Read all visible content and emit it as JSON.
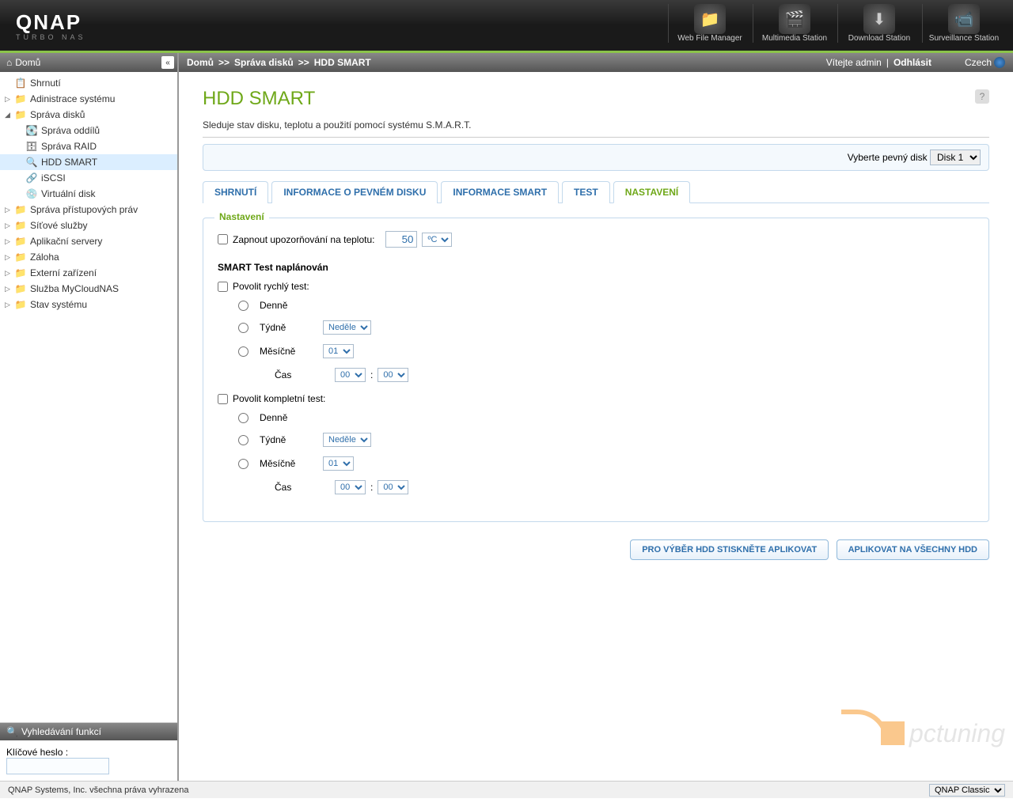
{
  "brand": {
    "main": "QNAP",
    "sub": "TURBO NAS"
  },
  "header_icons": [
    {
      "label": "Web File Manager",
      "glyph": "📁"
    },
    {
      "label": "Multimedia Station",
      "glyph": "🎬"
    },
    {
      "label": "Download Station",
      "glyph": "⬇"
    },
    {
      "label": "Surveillance Station",
      "glyph": "📹"
    }
  ],
  "sidebar": {
    "home": "Domů",
    "items": [
      {
        "label": "Shrnutí",
        "icon": "📋",
        "type": "item"
      },
      {
        "label": "Adinistrace systému",
        "icon": "📁",
        "type": "folder",
        "expandable": true
      },
      {
        "label": "Správa disků",
        "icon": "📁",
        "type": "folder",
        "expandable": true,
        "expanded": true,
        "children": [
          {
            "label": "Správa oddílů",
            "icon": "💽"
          },
          {
            "label": "Správa RAID",
            "icon": "🗄"
          },
          {
            "label": "HDD SMART",
            "icon": "🔍",
            "selected": true
          },
          {
            "label": "iSCSI",
            "icon": "🔗"
          },
          {
            "label": "Virtuální disk",
            "icon": "💿"
          }
        ]
      },
      {
        "label": "Správa přístupových práv",
        "icon": "📁",
        "type": "folder",
        "expandable": true
      },
      {
        "label": "Síťové služby",
        "icon": "📁",
        "type": "folder",
        "expandable": true
      },
      {
        "label": "Aplikační servery",
        "icon": "📁",
        "type": "folder",
        "expandable": true
      },
      {
        "label": "Záloha",
        "icon": "📁",
        "type": "folder",
        "expandable": true
      },
      {
        "label": "Externí zařízení",
        "icon": "📁",
        "type": "folder",
        "expandable": true
      },
      {
        "label": "Služba MyCloudNAS",
        "icon": "📁",
        "type": "folder",
        "expandable": true
      },
      {
        "label": "Stav systému",
        "icon": "📁",
        "type": "folder",
        "expandable": true
      }
    ]
  },
  "search": {
    "title": "Vyhledávání funkcí",
    "label": "Klíčové heslo :"
  },
  "breadcrumb": {
    "parts": [
      "Domů",
      "Správa disků",
      "HDD SMART"
    ],
    "welcome": "Vítejte admin",
    "logout": "Odhlásit",
    "lang": "Czech"
  },
  "page": {
    "title": "HDD SMART",
    "desc": "Sleduje stav disku, teplotu a použití pomocí systému S.M.A.R.T.",
    "disk_select_label": "Vyberte pevný disk",
    "disk_select_value": "Disk 1",
    "tabs": [
      "SHRNUTÍ",
      "INFORMACE O PEVNÉM DISKU",
      "INFORMACE SMART",
      "TEST",
      "NASTAVENÍ"
    ],
    "active_tab": 4,
    "settings": {
      "legend": "Nastavení",
      "temp_alarm": "Zapnout upozorňování na teplotu:",
      "temp_value": "50",
      "temp_unit": "ºC",
      "test_scheduled": "SMART Test naplánován",
      "quick_label": "Povolit rychlý test:",
      "full_label": "Povolit kompletní test:",
      "daily": "Denně",
      "weekly": "Týdně",
      "monthly": "Měsíčně",
      "time": "Čas",
      "week_value": "Neděle",
      "month_value": "01",
      "hour_value": "00",
      "min_value": "00"
    },
    "buttons": {
      "apply_selected": "PRO VÝBĚR HDD STISKNĚTE APLIKOVAT",
      "apply_all": "APLIKOVAT NA VŠECHNY HDD"
    }
  },
  "footer": {
    "copyright": "QNAP Systems, Inc. všechna práva vyhrazena",
    "theme": "QNAP Classic"
  },
  "watermark": "pctuning"
}
